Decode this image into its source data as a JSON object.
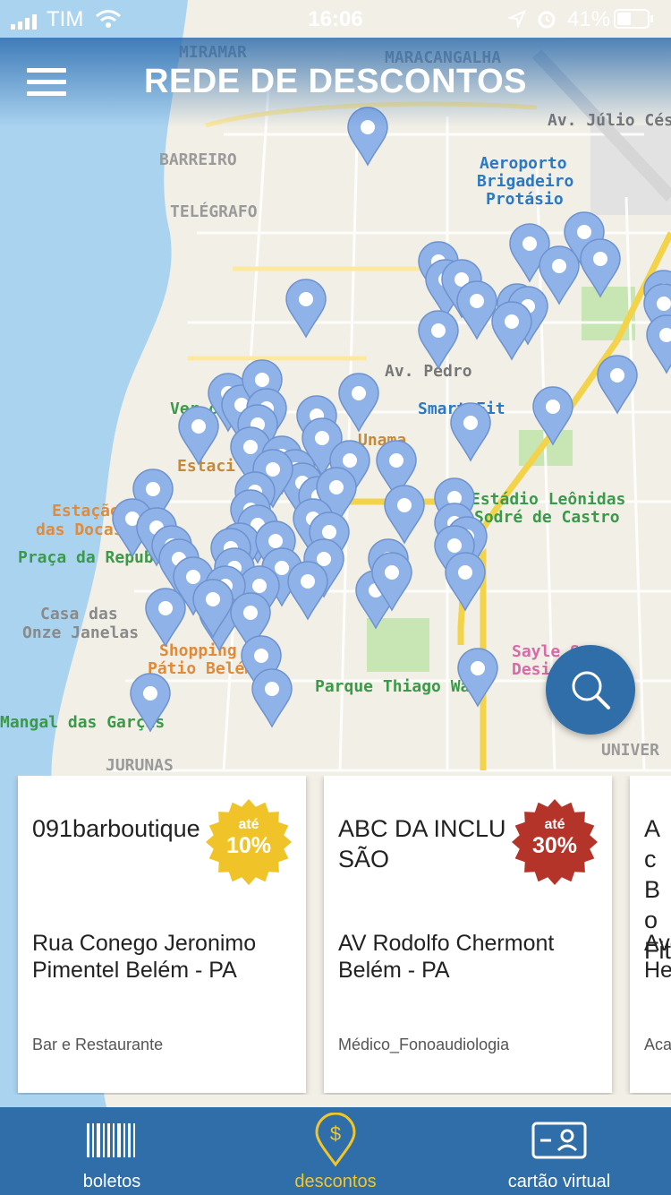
{
  "status": {
    "carrier": "TIM",
    "time": "16:06",
    "battery": "41%"
  },
  "header": {
    "title": "REDE DE DESCONTOS",
    "menu_icon": "hamburger-icon"
  },
  "map": {
    "labels": [
      "MIRAMAR",
      "MARACANGALHA",
      "BARREIRO",
      "TELÉGRAFO",
      "Aeroporto",
      "Brigadeiro",
      "Protásio",
      "Av. Júlio César",
      "Av. Pedro",
      "Smart Fit",
      "Ver-o",
      "Estaci",
      "Unama",
      "Estádio Leônidas",
      "Sodré de Castro",
      "Estação",
      "das Docas",
      "Praça da Repub",
      "Casa das",
      "Onze Janelas",
      "Shopping",
      "Pátio Belém",
      "Parque Thiago Wa",
      "Sayle S",
      "Desi",
      "Mangal das Garças",
      "JURUNAS",
      "UNIVER"
    ]
  },
  "search_icon": "search-icon",
  "cards": [
    {
      "name": "091barboutique",
      "address": "Rua Conego Jeronimo Pimentel Belém - PA",
      "category": "Bar e Restaurante",
      "badge_top": "até",
      "badge_value": "10%",
      "badge_color": "#f0c428"
    },
    {
      "name": "ABC DA INCLUSÃO",
      "address": "AV Rodolfo Chermont Belém - PA",
      "category": "Médico_Fonoaudiologia",
      "badge_top": "até",
      "badge_value": "30%",
      "badge_color": "#b5342a"
    },
    {
      "name": "Ac Bo Fit",
      "address": "Ave He",
      "category": "Aca"
    }
  ],
  "tabs": [
    {
      "label": "boletos",
      "icon": "barcode-icon"
    },
    {
      "label": "descontos",
      "icon": "discount-pin-icon"
    },
    {
      "label": "cartão virtual",
      "icon": "id-card-icon"
    }
  ],
  "colors": {
    "brand": "#2f6ea8",
    "active_tab": "#f3c628",
    "pin": "#8fb2e8"
  }
}
